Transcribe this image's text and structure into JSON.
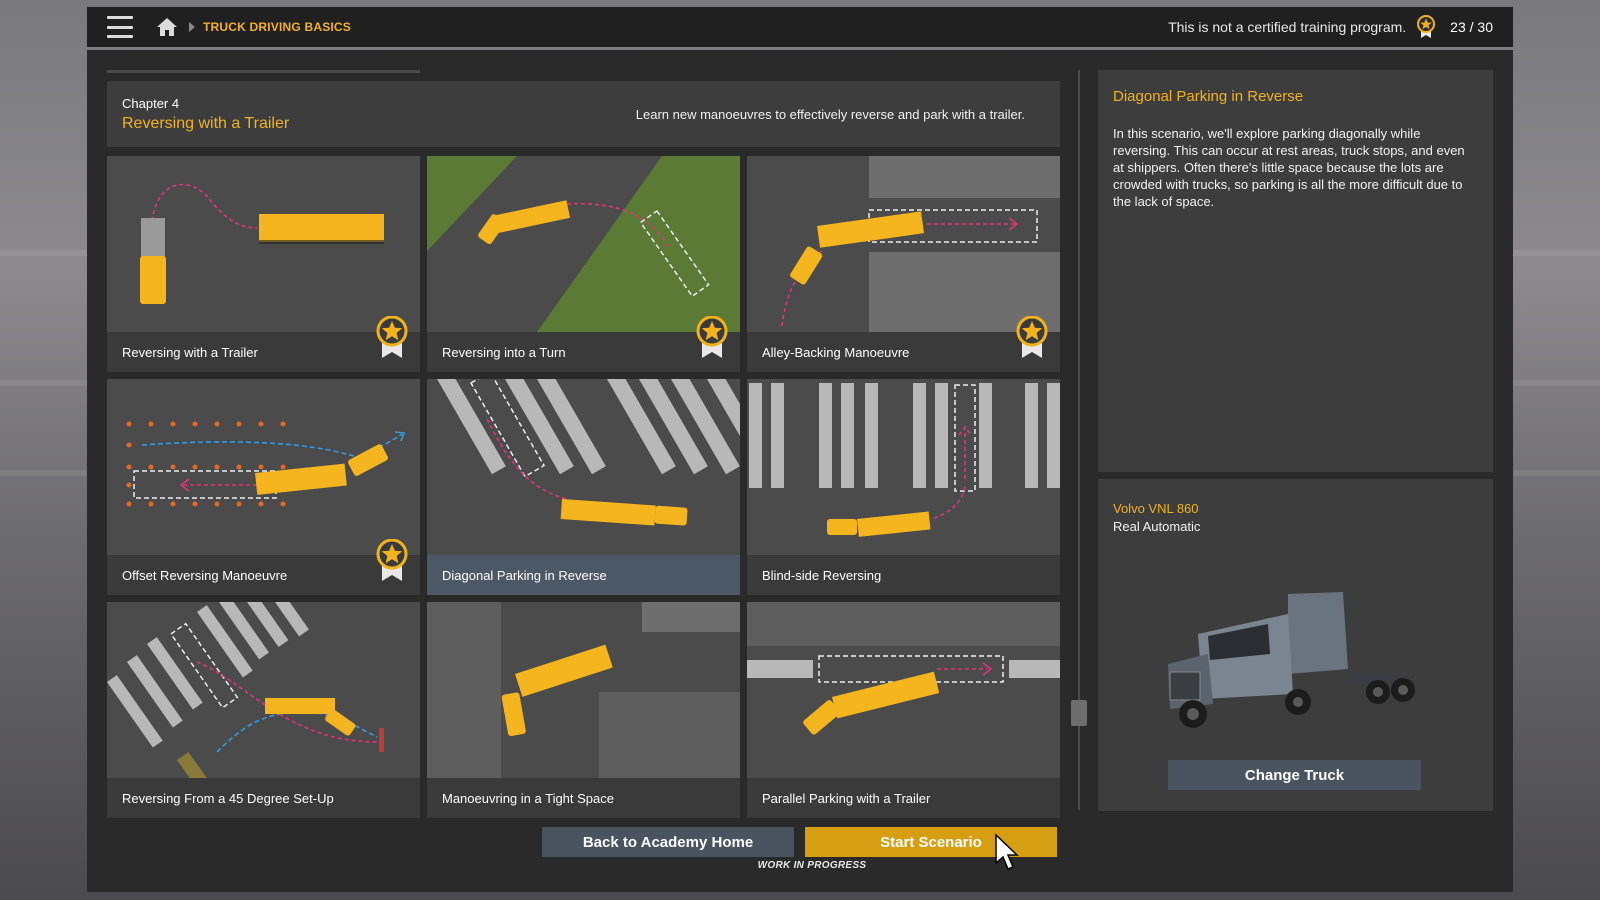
{
  "header": {
    "breadcrumb": "TRUCK DRIVING BASICS",
    "disclaimer": "This is not a certified training program.",
    "score": "23 / 30"
  },
  "chapter": {
    "number": "Chapter 4",
    "title": "Reversing with a Trailer",
    "description": "Learn new manoeuvres to effectively reverse and park with a trailer."
  },
  "scenarios": [
    {
      "label": "Reversing with a Trailer",
      "completed": true
    },
    {
      "label": "Reversing into a Turn",
      "completed": true
    },
    {
      "label": "Alley-Backing Manoeuvre",
      "completed": true
    },
    {
      "label": "Offset Reversing Manoeuvre",
      "completed": true
    },
    {
      "label": "Diagonal Parking in Reverse",
      "completed": false,
      "selected": true
    },
    {
      "label": "Blind-side Reversing",
      "completed": false
    },
    {
      "label": "Reversing From a 45 Degree Set-Up",
      "completed": false
    },
    {
      "label": "Manoeuvring in a Tight Space",
      "completed": false
    },
    {
      "label": "Parallel Parking with a Trailer",
      "completed": false
    }
  ],
  "details": {
    "title": "Diagonal Parking in Reverse",
    "text": "In this scenario, we'll explore parking diagonally while reversing. This can occur at rest areas, truck stops, and even at shippers. Often there's little space because the lots are crowded with trucks, so parking is all the more difficult due to the lack of space."
  },
  "truck": {
    "name": "Volvo VNL 860",
    "transmission": "Real Automatic",
    "change_label": "Change Truck"
  },
  "buttons": {
    "back": "Back to Academy Home",
    "start": "Start Scenario",
    "footer": "WORK IN PROGRESS"
  },
  "colors": {
    "accent": "#f2b21c",
    "panel": "#3d3d3d",
    "selected": "#4c5866",
    "start_button": "#d69e12",
    "trailer": "#f5b51f",
    "path": "#e0357a",
    "grass": "#5a7a35"
  },
  "icons": [
    "hamburger-icon",
    "home-icon",
    "chevron-right-icon",
    "medal-icon",
    "cursor-icon"
  ]
}
